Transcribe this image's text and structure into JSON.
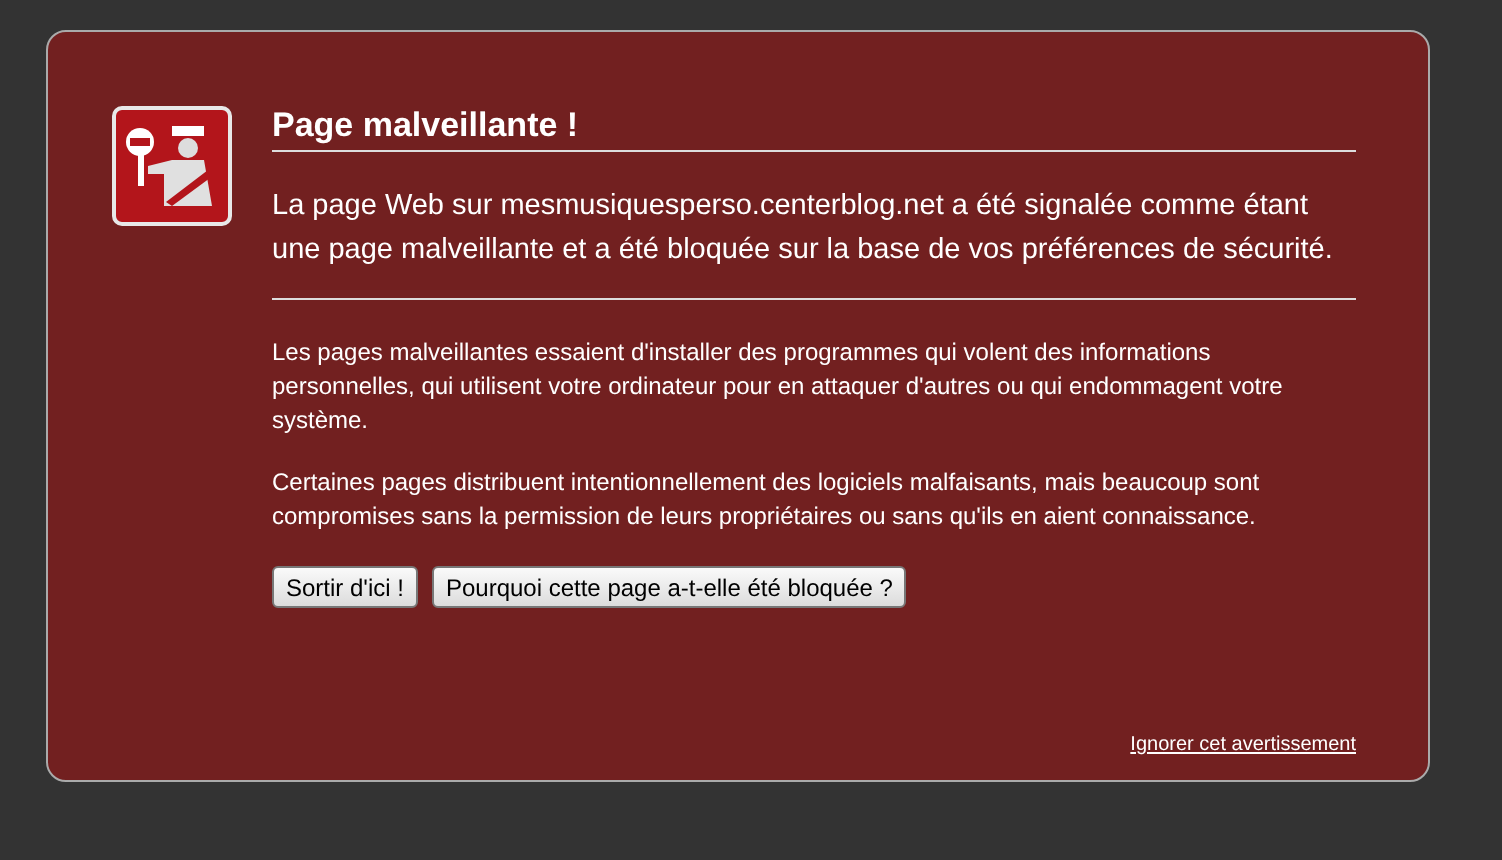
{
  "title": "Page malveillante !",
  "intro": "La page Web sur mesmusiquesperso.centerblog.net a été signalée comme étant une page malveillante et a été bloquée sur la base de vos préférences de sécurité.",
  "paragraphs": [
    "Les pages malveillantes essaient d'installer des programmes qui volent des informations personnelles, qui utilisent votre ordinateur pour en attaquer d'autres ou qui endommagent votre système.",
    "Certaines pages distribuent intentionnellement des logiciels malfaisants, mais beaucoup sont compromises sans la permission de leurs propriétaires ou sans qu'ils en aient connaissance."
  ],
  "buttons": [
    "Sortir d'ici !",
    "Pourquoi cette page a-t-elle été bloquée ?"
  ],
  "ignore_link": "Ignorer cet avertissement"
}
